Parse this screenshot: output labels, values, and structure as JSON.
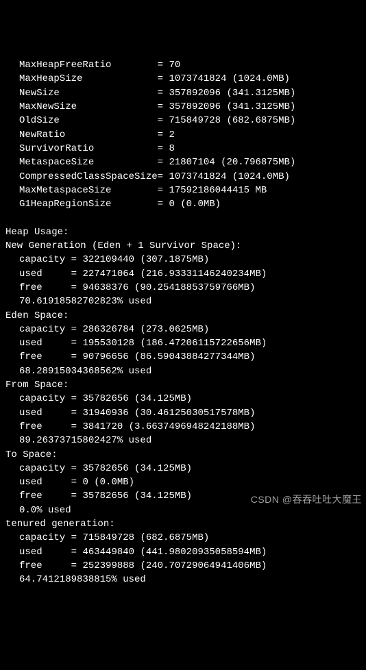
{
  "params": [
    {
      "name": "MaxHeapFreeRatio",
      "pad": 24,
      "value": "70"
    },
    {
      "name": "MaxHeapSize",
      "pad": 24,
      "value": "1073741824 (1024.0MB)"
    },
    {
      "name": "NewSize",
      "pad": 24,
      "value": "357892096 (341.3125MB)"
    },
    {
      "name": "MaxNewSize",
      "pad": 24,
      "value": "357892096 (341.3125MB)"
    },
    {
      "name": "OldSize",
      "pad": 24,
      "value": "715849728 (682.6875MB)"
    },
    {
      "name": "NewRatio",
      "pad": 24,
      "value": "2"
    },
    {
      "name": "SurvivorRatio",
      "pad": 24,
      "value": "8"
    },
    {
      "name": "MetaspaceSize",
      "pad": 24,
      "value": "21807104 (20.796875MB)"
    },
    {
      "name": "CompressedClassSpaceSize",
      "pad": 24,
      "value": "1073741824 (1024.0MB)"
    },
    {
      "name": "MaxMetaspaceSize",
      "pad": 24,
      "value": "17592186044415 MB"
    },
    {
      "name": "G1HeapRegionSize",
      "pad": 24,
      "value": "0 (0.0MB)"
    }
  ],
  "heap_header": "Heap Usage:",
  "sections": [
    {
      "title": "New Generation (Eden + 1 Survivor Space):",
      "rows": [
        {
          "name": "capacity",
          "value": "322109440 (307.1875MB)"
        },
        {
          "name": "used",
          "value": "227471064 (216.93331146240234MB)"
        },
        {
          "name": "free",
          "value": "94638376 (90.25418853759766MB)"
        }
      ],
      "pct": "70.61918582702823% used"
    },
    {
      "title": "Eden Space:",
      "rows": [
        {
          "name": "capacity",
          "value": "286326784 (273.0625MB)"
        },
        {
          "name": "used",
          "value": "195530128 (186.47206115722656MB)"
        },
        {
          "name": "free",
          "value": "90796656 (86.59043884277344MB)"
        }
      ],
      "pct": "68.28915034368562% used"
    },
    {
      "title": "From Space:",
      "rows": [
        {
          "name": "capacity",
          "value": "35782656 (34.125MB)"
        },
        {
          "name": "used",
          "value": "31940936 (30.46125030517578MB)"
        },
        {
          "name": "free",
          "value": "3841720 (3.6637496948242188MB)"
        }
      ],
      "pct": "89.26373715802427% used"
    },
    {
      "title": "To Space:",
      "rows": [
        {
          "name": "capacity",
          "value": "35782656 (34.125MB)"
        },
        {
          "name": "used",
          "value": "0 (0.0MB)"
        },
        {
          "name": "free",
          "value": "35782656 (34.125MB)"
        }
      ],
      "pct": "0.0% used"
    },
    {
      "title": "tenured generation:",
      "rows": [
        {
          "name": "capacity",
          "value": "715849728 (682.6875MB)"
        },
        {
          "name": "used",
          "value": "463449840 (441.98020935058594MB)"
        },
        {
          "name": "free",
          "value": "252399888 (240.70729064941406MB)"
        }
      ],
      "pct": "64.7412189838815% used"
    }
  ],
  "watermark": "CSDN @吞吞吐吐大魔王"
}
